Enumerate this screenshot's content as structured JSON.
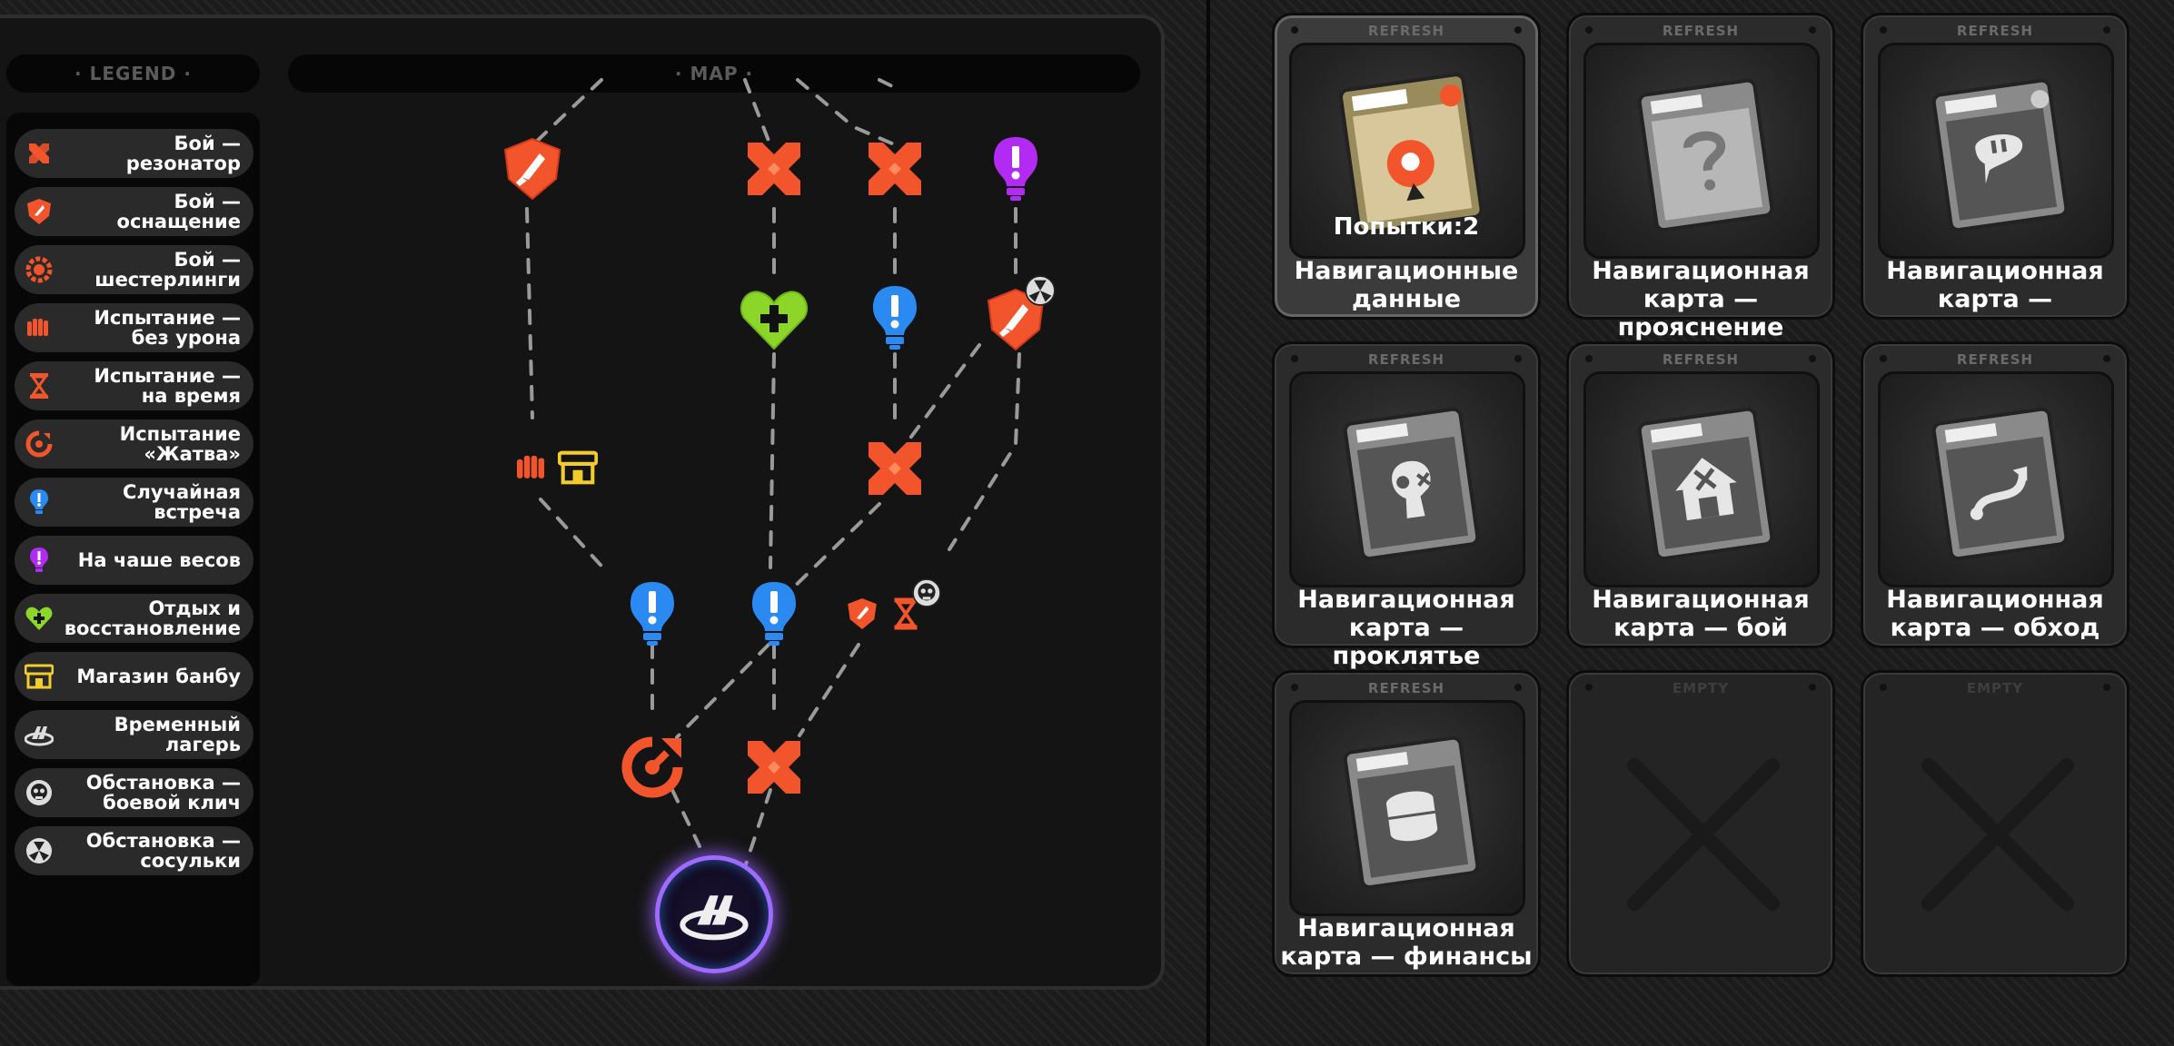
{
  "legend": {
    "header": "· LEGEND ·",
    "items": [
      {
        "label": "Бой —\nрезонатор",
        "icon": "crossed-swords-icon"
      },
      {
        "label": "Бой —\nоснащение",
        "icon": "shield-icon"
      },
      {
        "label": "Бой —\nшестерлинги",
        "icon": "gear-icon"
      },
      {
        "label": "Испытание —\nбез урона",
        "icon": "fist-icon"
      },
      {
        "label": "Испытание —\nна время",
        "icon": "hourglass-icon"
      },
      {
        "label": "Испытание\n«Жатва»",
        "icon": "harvest-icon"
      },
      {
        "label": "Случайная\nвстреча",
        "icon": "exclamation-bulb-icon"
      },
      {
        "label": "На чаше весов",
        "icon": "purple-bulb-icon"
      },
      {
        "label": "Отдых и\nвосстановление",
        "icon": "heart-plus-icon"
      },
      {
        "label": "Магазин банбу",
        "icon": "shop-icon"
      },
      {
        "label": "Временный\nлагерь",
        "icon": "camp-icon"
      },
      {
        "label": "Обстановка —\nбоевой клич",
        "icon": "skull-icon"
      },
      {
        "label": "Обстановка —\nсосульки",
        "icon": "icicle-icon"
      }
    ]
  },
  "map": {
    "header": "· MAP ·",
    "nodes": [
      {
        "id": "n-shield-top",
        "type": "shield"
      },
      {
        "id": "n-swords-1",
        "type": "swords"
      },
      {
        "id": "n-swords-2",
        "type": "swords"
      },
      {
        "id": "n-purple-top",
        "type": "purple"
      },
      {
        "id": "n-heart",
        "type": "heart"
      },
      {
        "id": "n-blue-1",
        "type": "blue"
      },
      {
        "id": "n-shield-icicle",
        "type": "shield"
      },
      {
        "id": "n-fist-shop",
        "type": "fist-shop"
      },
      {
        "id": "n-swords-mid",
        "type": "swords"
      },
      {
        "id": "n-blue-2",
        "type": "blue"
      },
      {
        "id": "n-blue-3",
        "type": "blue"
      },
      {
        "id": "n-shield-hourglass",
        "type": "shield-hourglass"
      },
      {
        "id": "n-harvest",
        "type": "harvest"
      },
      {
        "id": "n-swords-low",
        "type": "swords"
      },
      {
        "id": "n-camp",
        "type": "camp"
      }
    ]
  },
  "cards": [
    {
      "tag": "REFRESH",
      "name": "Навигационные\nданные",
      "attempts": "Попытки:2",
      "art": "orange-pin-icon",
      "selected": true
    },
    {
      "tag": "REFRESH",
      "name": "Навигационная\nкарта — прояснение",
      "attempts": "",
      "art": "question-icon",
      "selected": false
    },
    {
      "tag": "REFRESH",
      "name": "Навигационная\nкарта —",
      "attempts": "",
      "art": "chat-icon",
      "selected": false
    },
    {
      "tag": "REFRESH",
      "name": "Навигационная\nкарта — проклятье",
      "attempts": "",
      "art": "curse-icon",
      "selected": false
    },
    {
      "tag": "REFRESH",
      "name": "Навигационная\nкарта — бой",
      "attempts": "",
      "art": "battle-icon",
      "selected": false
    },
    {
      "tag": "REFRESH",
      "name": "Навигационная\nкарта — обход",
      "attempts": "",
      "art": "detour-icon",
      "selected": false
    },
    {
      "tag": "REFRESH",
      "name": "Навигационная\nкарта — финансы",
      "attempts": "",
      "art": "coins-icon",
      "selected": false
    },
    {
      "tag": "EMPTY",
      "name": "",
      "attempts": "",
      "art": "empty-x-icon",
      "selected": false
    },
    {
      "tag": "EMPTY",
      "name": "",
      "attempts": "",
      "art": "empty-x-icon",
      "selected": false
    }
  ],
  "colors": {
    "orange": "#f2552b",
    "blue": "#2b8af2",
    "purple": "#b12bf2",
    "green": "#8cd629",
    "yellow": "#f2cc2b"
  }
}
